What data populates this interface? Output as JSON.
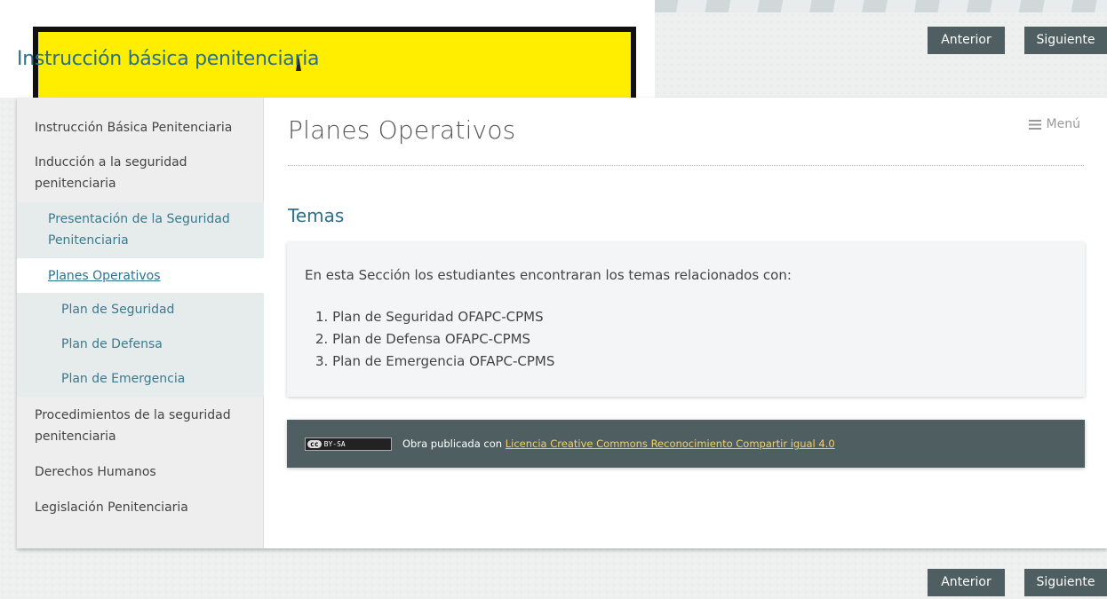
{
  "header": {
    "site_title": "Instrucción básica penitenciaria",
    "prev_label": "Anterior",
    "next_label": "Siguiente"
  },
  "sidebar": {
    "items": [
      {
        "label": "Instrucción Básica Penitenciaria"
      },
      {
        "label": "Inducción a la seguridad penitenciaria"
      },
      {
        "label": "Presentación de la Seguridad Penitenciaria"
      },
      {
        "label": "Planes Operativos",
        "active": true
      },
      {
        "label": "Plan de Seguridad"
      },
      {
        "label": "Plan de Defensa"
      },
      {
        "label": "Plan de Emergencia"
      },
      {
        "label": "Procedimientos de la seguridad penitenciaria"
      },
      {
        "label": "Derechos Humanos"
      },
      {
        "label": "Legislación Penitenciaria"
      }
    ]
  },
  "main": {
    "page_title": "Planes Operativos",
    "menu_label": "Menú",
    "menu_icon": "hamburger-icon",
    "section_title": "Temas",
    "intro": "En esta Sección los estudiantes encontraran los temas relacionados con:",
    "topics": [
      "1. Plan de Seguridad OFAPC-CPMS",
      "2. Plan de Defensa OFAPC-CPMS",
      "3. Plan de Emergencia OFAPC-CPMS"
    ]
  },
  "license": {
    "badge_cc": "cc",
    "badge_text": "BY-SA",
    "prefix": "Obra publicada con",
    "link_text": "Licencia Creative Commons Reconocimiento Compartir igual 4.0"
  },
  "footer": {
    "prev_label": "Anterior",
    "next_label": "Siguiente"
  },
  "colors": {
    "accent": "#2d7089",
    "button_bg": "#4f5e60",
    "banner_yellow": "#ffee00",
    "license_link": "#f3cf6b"
  }
}
